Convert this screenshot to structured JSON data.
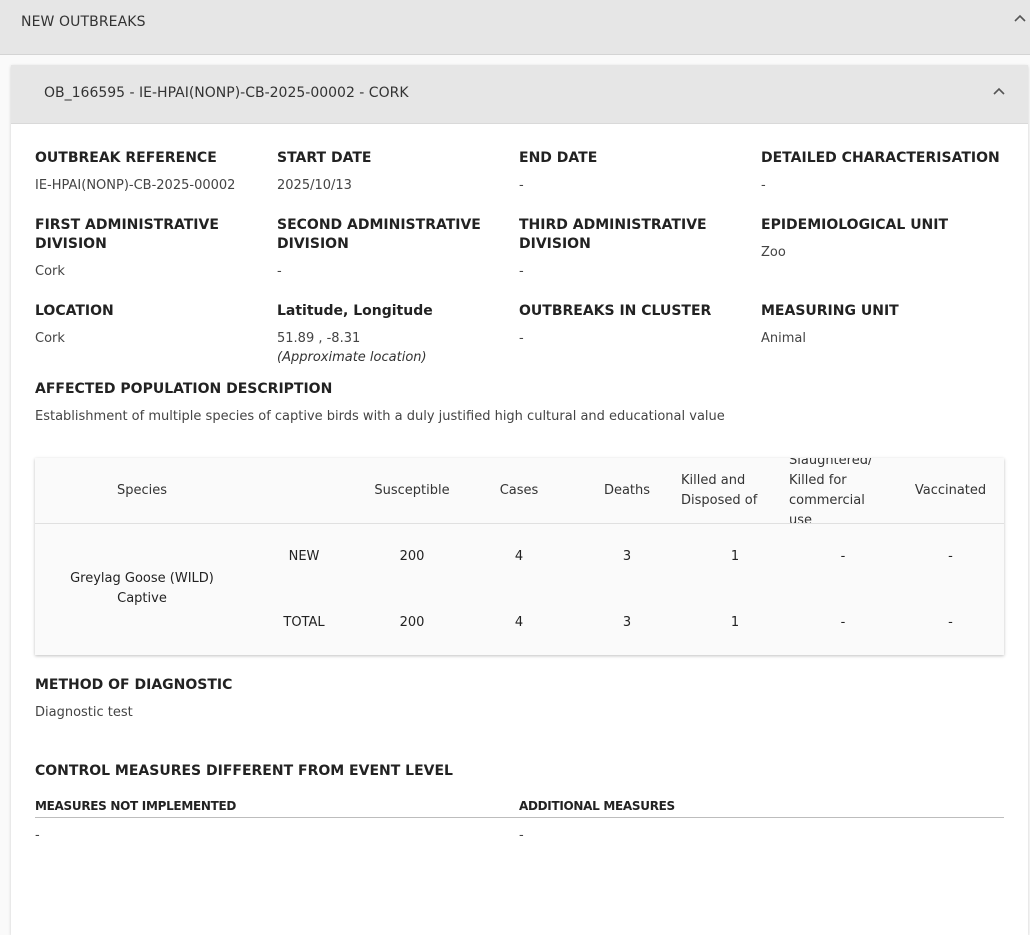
{
  "outer_section": {
    "title": "NEW OUTBREAKS"
  },
  "outbreak": {
    "header_title": "OB_166595 - IE-HPAI(NONP)-CB-2025-00002 - CORK",
    "fields": {
      "outbreak_reference": {
        "label": "OUTBREAK REFERENCE",
        "value": "IE-HPAI(NONP)-CB-2025-00002"
      },
      "start_date": {
        "label": "START DATE",
        "value": "2025/10/13"
      },
      "end_date": {
        "label": "END DATE",
        "value": "-"
      },
      "detailed_characterisation": {
        "label": "DETAILED CHARACTERISATION",
        "value": "-"
      },
      "first_admin_division": {
        "label_line1": "FIRST ADMINISTRATIVE",
        "label_line2": "DIVISION",
        "value": "Cork"
      },
      "second_admin_division": {
        "label_line1": "SECOND ADMINISTRATIVE",
        "label_line2": "DIVISION",
        "value": "-"
      },
      "third_admin_division": {
        "label_line1": "THIRD ADMINISTRATIVE",
        "label_line2": "DIVISION",
        "value": "-"
      },
      "epidemiological_unit": {
        "label": "EPIDEMIOLOGICAL UNIT",
        "value": "Zoo"
      },
      "location": {
        "label": "LOCATION",
        "value": "Cork"
      },
      "lat_long": {
        "label": "Latitude, Longitude",
        "value": "51.89 , -8.31",
        "note": "(Approximate location)"
      },
      "outbreaks_in_cluster": {
        "label": "OUTBREAKS IN CLUSTER",
        "value": "-"
      },
      "measuring_unit": {
        "label": "MEASURING UNIT",
        "value": "Animal"
      },
      "affected_population": {
        "label": "AFFECTED POPULATION DESCRIPTION",
        "value": "Establishment of multiple species of captive birds with a duly justified high cultural and educational value"
      }
    },
    "species_table": {
      "headers": {
        "species": "Species",
        "susceptible": "Susceptible",
        "cases": "Cases",
        "deaths": "Deaths",
        "killed_line1": "Killed and",
        "killed_line2": "Disposed of",
        "slaughtered_line1": "Slaughtered/",
        "slaughtered_line2": "Killed for",
        "slaughtered_line3": "commercial",
        "slaughtered_line4": "use",
        "vaccinated": "Vaccinated"
      },
      "species_name_line1": "Greylag Goose (WILD)",
      "species_name_line2": "Captive",
      "rows": [
        {
          "type": "NEW",
          "susceptible": "200",
          "cases": "4",
          "deaths": "3",
          "killed": "1",
          "slaughtered": "-",
          "vaccinated": "-"
        },
        {
          "type": "TOTAL",
          "susceptible": "200",
          "cases": "4",
          "deaths": "3",
          "killed": "1",
          "slaughtered": "-",
          "vaccinated": "-"
        }
      ]
    },
    "method_of_diagnostic": {
      "label": "METHOD OF DIAGNOSTIC",
      "value": "Diagnostic test"
    },
    "control_measures": {
      "title": "CONTROL MEASURES DIFFERENT FROM EVENT LEVEL",
      "not_implemented_label": "MEASURES NOT IMPLEMENTED",
      "not_implemented_value": "-",
      "additional_label": "ADDITIONAL MEASURES",
      "additional_value": "-"
    }
  },
  "icons": {
    "collapse": "chevron-up-icon"
  },
  "colors": {
    "header_bg": "#e6e6e6",
    "card_bg": "#ffffff",
    "page_bg": "#fafafa"
  }
}
